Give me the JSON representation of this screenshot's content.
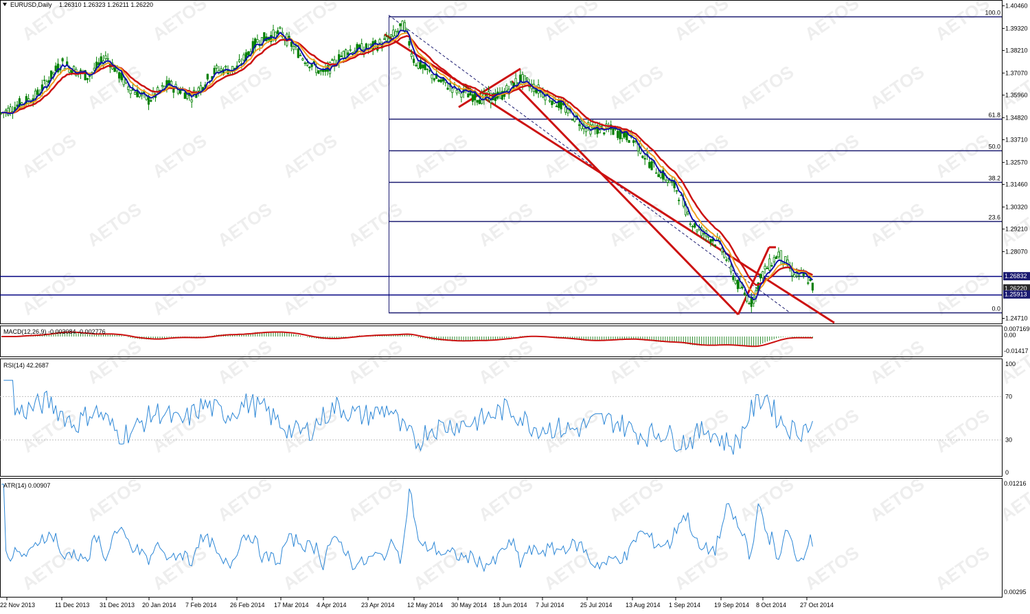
{
  "header": {
    "symbol": "EURUSD,Daily",
    "ohlc": "1.26310 1.26323 1.26211 1.26220"
  },
  "watermark": "AETOS",
  "colors": {
    "background": "#ffffff",
    "candle": "#008000",
    "ma_fast": "#1111aa",
    "ma_mid": "#f0a020",
    "ma_slow": "#cc1111",
    "channel": "#cc1111",
    "fib_line": "#1a1a70",
    "level_line": "#000080",
    "macd_hist": "#2e8b2e",
    "macd_signal": "#cc1111",
    "rsi": "#2b86d6",
    "atr": "#2b86d6",
    "price_tag": "#1a1a70",
    "price_tag_current": "#2c2c2c"
  },
  "price_axis": {
    "ticks": [
      "1.40460",
      "1.39320",
      "1.38210",
      "1.37070",
      "1.35960",
      "1.34820",
      "1.33710",
      "1.32570",
      "1.31460",
      "1.30320",
      "1.29210",
      "1.28070",
      "1.26832",
      "1.26220",
      "1.25913",
      "1.24710"
    ],
    "tagged": [
      "1.26832",
      "1.26220",
      "1.25913"
    ]
  },
  "fibonacci": {
    "levels": [
      {
        "label": "100.0",
        "price": 1.3993
      },
      {
        "label": "61.8",
        "price": 1.3477
      },
      {
        "label": "50.0",
        "price": 1.3318
      },
      {
        "label": "38.2",
        "price": 1.3159
      },
      {
        "label": "23.6",
        "price": 1.2962
      },
      {
        "label": "0.0",
        "price": 1.2501
      }
    ]
  },
  "horizontal_levels": [
    1.26832,
    1.25913
  ],
  "macd": {
    "label": "MACD(12,26,9) -0.003084 -0.002776",
    "axis_ticks": [
      "0.007169",
      "0.00",
      "-0.01417"
    ]
  },
  "rsi": {
    "label": "RSI(14) 42.2687",
    "axis_ticks": [
      "100",
      "70",
      "30",
      "0"
    ]
  },
  "atr": {
    "label": "ATR(14) 0.00907",
    "axis_ticks": [
      "0.01216",
      "0.00295"
    ]
  },
  "date_axis": [
    "22 Nov 2013",
    "11 Dec 2013",
    "31 Dec 2013",
    "20 Jan 2014",
    "7 Feb 2014",
    "26 Feb 2014",
    "17 Mar 2014",
    "4 Apr 2014",
    "23 Apr 2014",
    "12 May 2014",
    "30 May 2014",
    "18 Jun 2014",
    "7 Jul 2014",
    "25 Jul 2014",
    "13 Aug 2014",
    "1 Sep 2014",
    "19 Sep 2014",
    "8 Oct 2014",
    "27 Oct 2014"
  ],
  "chart_data": {
    "type": "candlestick",
    "title": "EURUSD,Daily",
    "price_range": [
      1.2445,
      1.4075
    ],
    "price_keypoints": [
      [
        "22 Nov 2013",
        1.35
      ],
      [
        "2 Dec 2013",
        1.359
      ],
      [
        "11 Dec 2013",
        1.376
      ],
      [
        "17 Dec 2013",
        1.372
      ],
      [
        "23 Dec 2013",
        1.369
      ],
      [
        "31 Dec 2013",
        1.379
      ],
      [
        "10 Jan 2014",
        1.364
      ],
      [
        "20 Jan 2014",
        1.357
      ],
      [
        "28 Jan 2014",
        1.365
      ],
      [
        "7 Feb 2014",
        1.359
      ],
      [
        "17 Feb 2014",
        1.372
      ],
      [
        "26 Feb 2014",
        1.373
      ],
      [
        "7 Mar 2014",
        1.387
      ],
      [
        "17 Mar 2014",
        1.391
      ],
      [
        "26 Mar 2014",
        1.379
      ],
      [
        "4 Apr 2014",
        1.37
      ],
      [
        "14 Apr 2014",
        1.382
      ],
      [
        "23 Apr 2014",
        1.383
      ],
      [
        "1 May 2014",
        1.387
      ],
      [
        "8 May 2014",
        1.395
      ],
      [
        "12 May 2014",
        1.377
      ],
      [
        "22 May 2014",
        1.367
      ],
      [
        "30 May 2014",
        1.362
      ],
      [
        "9 Jun 2014",
        1.358
      ],
      [
        "18 Jun 2014",
        1.359
      ],
      [
        "27 Jun 2014",
        1.368
      ],
      [
        "7 Jul 2014",
        1.361
      ],
      [
        "16 Jul 2014",
        1.353
      ],
      [
        "25 Jul 2014",
        1.343
      ],
      [
        "4 Aug 2014",
        1.342
      ],
      [
        "13 Aug 2014",
        1.338
      ],
      [
        "21 Aug 2014",
        1.325
      ],
      [
        "1 Sep 2014",
        1.313
      ],
      [
        "8 Sep 2014",
        1.294
      ],
      [
        "19 Sep 2014",
        1.284
      ],
      [
        "26 Sep 2014",
        1.265
      ],
      [
        "3 Oct 2014",
        1.255
      ],
      [
        "8 Oct 2014",
        1.27
      ],
      [
        "15 Oct 2014",
        1.28
      ],
      [
        "21 Oct 2014",
        1.27
      ],
      [
        "27 Oct 2014",
        1.268
      ],
      [
        "30 Oct 2014",
        1.2622
      ]
    ],
    "last_close": 1.2622,
    "indicators": [
      "MACD(12,26,9)",
      "RSI(14)",
      "ATR(14)"
    ]
  }
}
